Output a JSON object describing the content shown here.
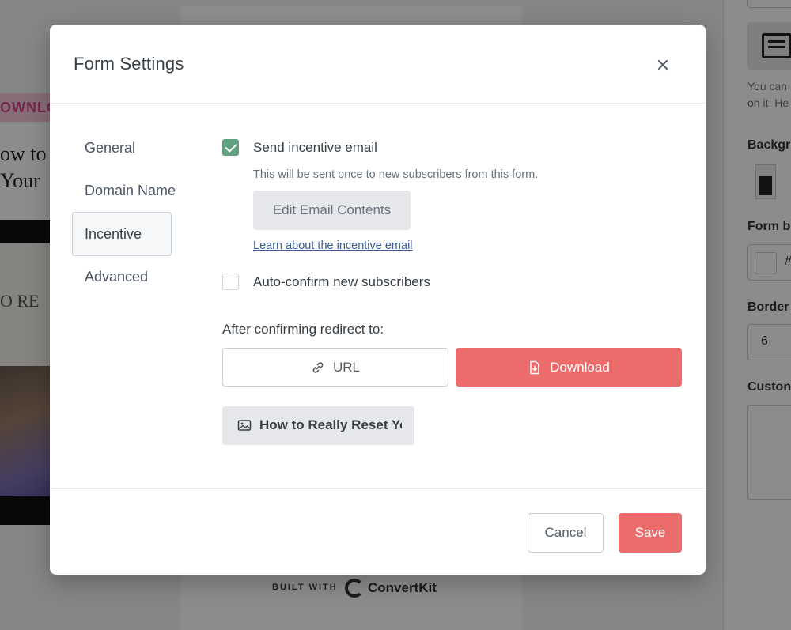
{
  "modal": {
    "title": "Form Settings",
    "close_label": "×"
  },
  "nav": {
    "items": [
      {
        "label": "General",
        "active": false
      },
      {
        "label": "Domain Name",
        "active": false
      },
      {
        "label": "Incentive",
        "active": true
      },
      {
        "label": "Advanced",
        "active": false
      }
    ]
  },
  "incentive": {
    "send_email_label": "Send incentive email",
    "send_email_checked": true,
    "helper_text": "This will be sent once to new subscribers from this form.",
    "edit_button_label": "Edit Email Contents",
    "learn_link_label": "Learn about the incentive email",
    "auto_confirm_label": "Auto-confirm new subscribers",
    "auto_confirm_checked": false,
    "redirect_label": "After confirming redirect to:",
    "redirect_options": [
      {
        "label": "URL",
        "icon": "link-icon",
        "selected": false
      },
      {
        "label": "Download",
        "icon": "file-download-icon",
        "selected": true
      }
    ],
    "download_file_name": "How to Really Reset Your"
  },
  "footer": {
    "cancel_label": "Cancel",
    "save_label": "Save"
  },
  "background": {
    "banner_text": "OWNLO",
    "title_line_1": "ow to",
    "title_line_2": "Your",
    "book_text": "O RE",
    "built_with": "BUILT WITH",
    "brand": "ConvertKit",
    "panel_hint": "You can",
    "panel_hint_2": "on it. He",
    "background_label": "Backgr",
    "form_label": "Form b",
    "border_label": "Border",
    "border_value": "6",
    "custom_label": "Custon",
    "hash": "#"
  },
  "colors": {
    "accent": "#ec6b6b",
    "check": "#5fa07e",
    "link": "#3c5d96"
  }
}
